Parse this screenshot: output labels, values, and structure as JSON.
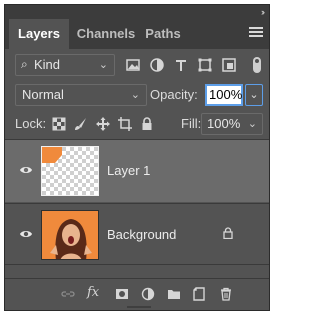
{
  "tabs": [
    {
      "label": "Layers",
      "active": true
    },
    {
      "label": "Channels",
      "active": false
    },
    {
      "label": "Paths",
      "active": false
    }
  ],
  "filter": {
    "kind_label": "Kind",
    "icons": [
      "pixel-filter-icon",
      "adjustment-filter-icon",
      "type-filter-icon",
      "shape-filter-icon",
      "smart-object-filter-icon"
    ]
  },
  "blend": {
    "mode": "Normal",
    "opacity_label": "Opacity:",
    "opacity_value": "100%"
  },
  "lock": {
    "label": "Lock:",
    "fill_label": "Fill:",
    "fill_value": "100%"
  },
  "layers": [
    {
      "name": "Layer 1",
      "selected": true,
      "visible": true,
      "locked": false
    },
    {
      "name": "Background",
      "selected": false,
      "visible": true,
      "locked": true
    }
  ],
  "colors": {
    "panel": "#535353",
    "tab_bar": "#3c3c3c",
    "selected_layer": "#6b6b6b",
    "focus_blue": "#5d9ee8",
    "thumb_orange": "#f08a3c"
  },
  "footer_icons": [
    "link-layers-icon",
    "fx-icon",
    "add-mask-icon",
    "adjustment-layer-icon",
    "new-group-icon",
    "new-layer-icon",
    "delete-icon"
  ]
}
